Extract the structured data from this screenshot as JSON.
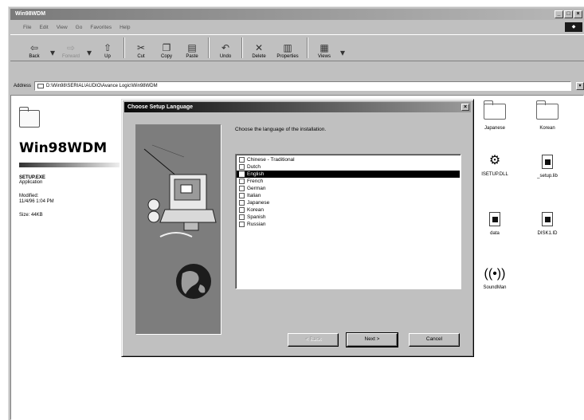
{
  "window": {
    "title": "Win98WDM"
  },
  "menu": {
    "items": [
      "File",
      "Edit",
      "View",
      "Go",
      "Favorites",
      "Help"
    ]
  },
  "toolbar": {
    "buttons": [
      {
        "label": "Back",
        "icon": "back-arrow-icon",
        "enabled": true
      },
      {
        "label": "Forward",
        "icon": "forward-arrow-icon",
        "enabled": false
      },
      {
        "label": "Up",
        "icon": "up-folder-icon",
        "enabled": true
      },
      {
        "label": "Cut",
        "icon": "scissors-icon",
        "enabled": true
      },
      {
        "label": "Copy",
        "icon": "copy-icon",
        "enabled": true
      },
      {
        "label": "Paste",
        "icon": "paste-icon",
        "enabled": true
      },
      {
        "label": "Undo",
        "icon": "undo-icon",
        "enabled": true
      },
      {
        "label": "Delete",
        "icon": "delete-x-icon",
        "enabled": true
      },
      {
        "label": "Properties",
        "icon": "properties-icon",
        "enabled": true
      },
      {
        "label": "Views",
        "icon": "views-icon",
        "enabled": true
      }
    ]
  },
  "address": {
    "label": "Address",
    "value": "D:\\Win98\\SERIAL\\AUDIO\\Avance Logic\\Win98WDM"
  },
  "infopane": {
    "folder_name": "Win98WDM",
    "file_name": "SETUP.EXE",
    "file_type": "Application",
    "modified_label": "Modified:",
    "modified_value": "11/4/96 1:04 PM",
    "size": "Size: 44KB"
  },
  "files": [
    {
      "label": "Japanese",
      "kind": "folder"
    },
    {
      "label": "Korean",
      "kind": "folder"
    },
    {
      "label": "ISETUP.DLL",
      "kind": "dll"
    },
    {
      "label": "_setup.lib",
      "kind": "doc"
    },
    {
      "label": "data",
      "kind": "doc"
    },
    {
      "label": "DISK1.ID",
      "kind": "doc"
    },
    {
      "label": "SoundMan",
      "kind": "sound"
    }
  ],
  "dialog": {
    "title": "Choose Setup Language",
    "prompt": "Choose the language of the installation.",
    "languages": [
      "Chinese - Traditional",
      "Dutch",
      "English",
      "French",
      "German",
      "Italian",
      "Japanese",
      "Korean",
      "Spanish",
      "Russian"
    ],
    "selected_language": "English",
    "back_label": "< Back",
    "next_label": "Next >",
    "cancel_label": "Cancel"
  }
}
